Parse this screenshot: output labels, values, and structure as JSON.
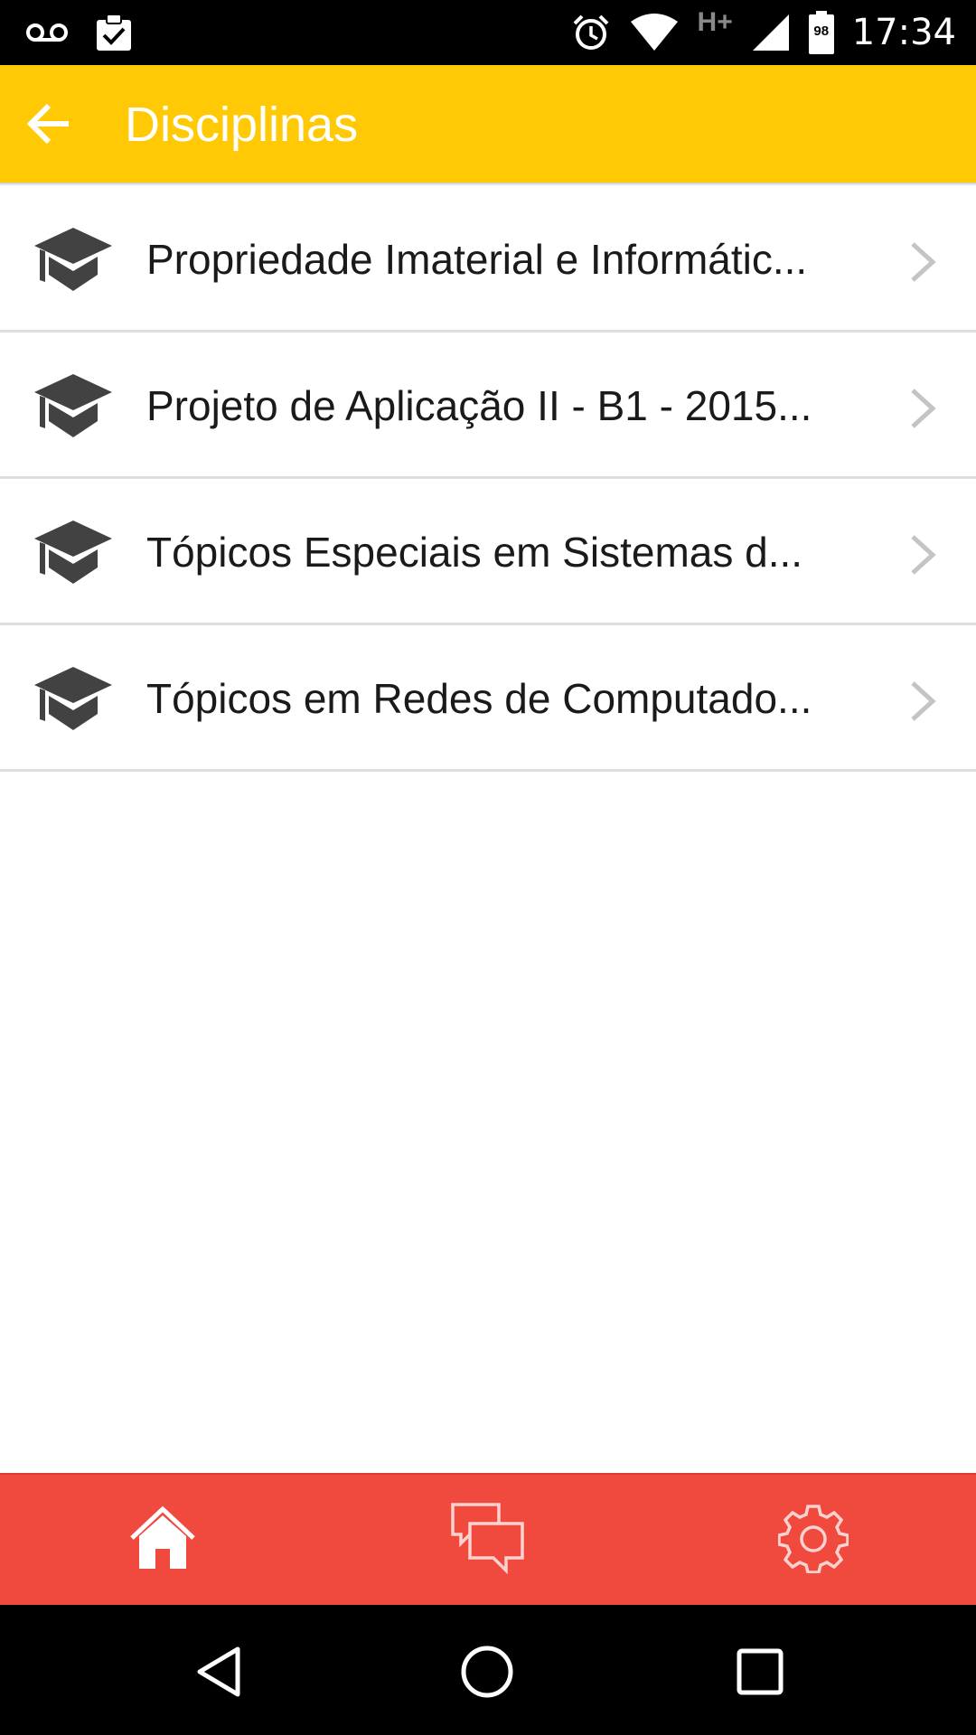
{
  "status_bar": {
    "time": "17:34",
    "battery_level": "98",
    "network_type": "H+",
    "icons": [
      "voicemail-icon",
      "clipboard-check-icon",
      "alarm-icon",
      "wifi-icon",
      "cell-signal-icon",
      "battery-icon"
    ]
  },
  "app_bar": {
    "title": "Disciplinas",
    "back_icon": "arrow-back-icon",
    "background": "#ffca05"
  },
  "disciplines": [
    {
      "label": "Propriedade Imaterial e Informátic...",
      "icon": "graduation-cap-icon"
    },
    {
      "label": "Projeto de Aplicação II - B1 - 2015...",
      "icon": "graduation-cap-icon"
    },
    {
      "label": "Tópicos Especiais em Sistemas d...",
      "icon": "graduation-cap-icon"
    },
    {
      "label": "Tópicos em Redes de Computado...",
      "icon": "graduation-cap-icon"
    }
  ],
  "bottom_nav": {
    "background": "#f0493e",
    "items": [
      {
        "icon": "home-icon",
        "active": true
      },
      {
        "icon": "chat-bubbles-icon",
        "active": false
      },
      {
        "icon": "gear-icon",
        "active": false
      }
    ]
  },
  "system_nav": {
    "items": [
      "back-triangle-icon",
      "home-circle-icon",
      "recent-apps-icon"
    ]
  }
}
